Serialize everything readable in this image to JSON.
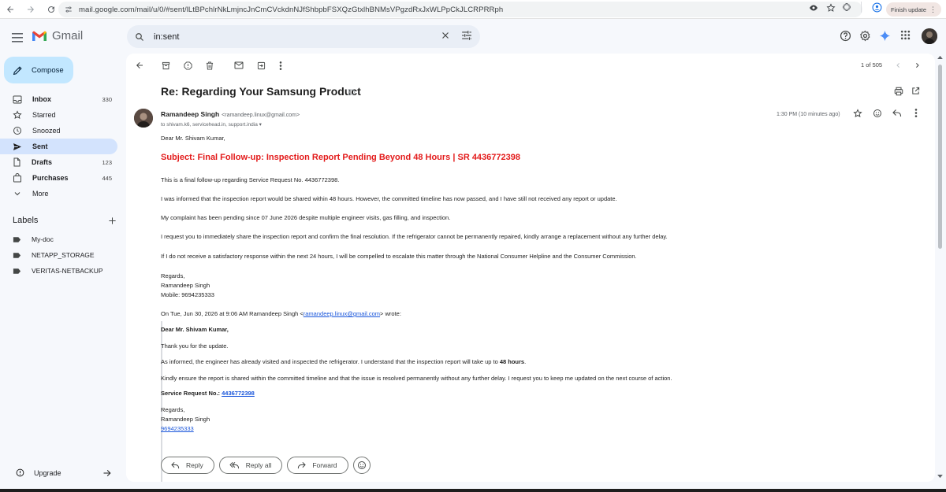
{
  "browser": {
    "url": "mail.google.com/mail/u/0/#sent/lLtBPchlrNkLmjncJnCmCVckdnNJfShbpbFSXQzGtxlhBNMsVPgzdRxJxWLPpCkJLCRPRRph",
    "finish_update_label": "Finish update"
  },
  "app": {
    "name": "Gmail"
  },
  "search": {
    "query": "in:sent"
  },
  "compose_label": "Compose",
  "nav": [
    {
      "label": "Inbox",
      "count": "330",
      "bold": true
    },
    {
      "label": "Starred",
      "count": ""
    },
    {
      "label": "Snoozed",
      "count": ""
    },
    {
      "label": "Sent",
      "count": "",
      "active": true
    },
    {
      "label": "Drafts",
      "count": "123",
      "bold": true
    },
    {
      "label": "Purchases",
      "count": "445",
      "bold": true
    },
    {
      "label": "More",
      "count": ""
    }
  ],
  "labels_heading": "Labels",
  "labels": [
    {
      "label": "My-doc"
    },
    {
      "label": "NETAPP_STORAGE"
    },
    {
      "label": "VERITAS-NETBACKUP"
    }
  ],
  "upgrade_label": "Upgrade",
  "pager": {
    "text": "1 of 505"
  },
  "email": {
    "subject": "Re: Regarding Your Samsung Product",
    "sender_name": "Ramandeep Singh",
    "sender_email": "<ramandeep.linux@gmail.com>",
    "recipients": "to shivam.k6, servicehead.in, support.india",
    "time": "1:30 PM (10 minutes ago)",
    "greeting": "Dear Mr. Shivam Kumar,",
    "big_subject": "Subject: Final Follow-up: Inspection Report Pending Beyond 48 Hours | SR 4436772398",
    "paragraphs": [
      "This is a final follow-up regarding Service Request No. 4436772398.",
      "I was informed that the inspection report would be shared within 48 hours. However, the committed timeline has now passed, and I have still not received any report or update.",
      "My complaint has been pending since 07 June 2026 despite multiple engineer visits, gas filling, and inspection.",
      "I request you to immediately share the inspection report and confirm the final resolution. If the refrigerator cannot be permanently repaired, kindly arrange a replacement without any further delay.",
      "If I do not receive a satisfactory response within the next 24 hours, I will be compelled to escalate this matter through the National Consumer Helpline and the Consumer Commission."
    ],
    "sign_regards": "Regards,",
    "sign_name": "Ramandeep Singh",
    "sign_mobile": "Mobile: 9694235333",
    "quote_intro_prefix": "On Tue, Jun 30, 2026 at 9:06 AM Ramandeep Singh <",
    "quote_intro_email": "ramandeep.linux@gmail.com",
    "quote_intro_suffix": "> wrote:",
    "quoted": {
      "greeting": "Dear Mr. Shivam Kumar,",
      "thanks": "Thank you for the update.",
      "informed_prefix": "As informed, the engineer has already visited and inspected the refrigerator. I understand that the inspection report will take up to ",
      "informed_bold": "48 hours",
      "informed_suffix": ".",
      "ensure": "Kindly ensure the report is shared within the committed timeline and that the issue is resolved permanently without any further delay. I request you to keep me updated on the next course of action.",
      "sr_label": "Service Request No.:",
      "sr_value": "4436772398",
      "regards": "Regards,",
      "name": "Ramandeep Singh",
      "phone": "9694235333"
    }
  },
  "reply_bar": {
    "reply": "Reply",
    "reply_all": "Reply all",
    "forward": "Forward"
  },
  "colors": {
    "subject_red": "#e31b1b",
    "compose_bg": "#c2e7ff",
    "active_nav": "#d3e3fd"
  }
}
